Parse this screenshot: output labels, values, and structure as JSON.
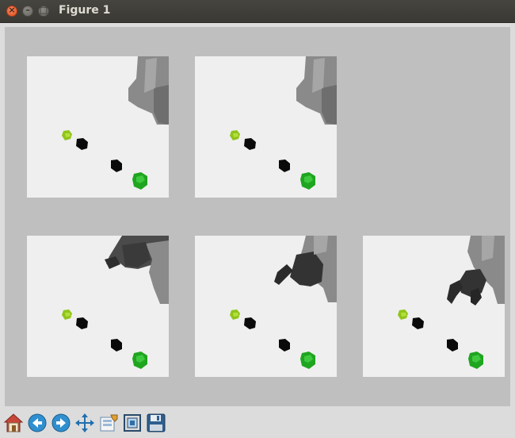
{
  "window": {
    "title": "Figure 1"
  },
  "titlebar": {
    "close_icon": "close-icon",
    "minimize_icon": "minimize-icon",
    "maximize_icon": "maximize-icon"
  },
  "figure": {
    "rows": 2,
    "panels": [
      {
        "name": "panel-row1-col1",
        "arm_pose": "arm-up"
      },
      {
        "name": "panel-row1-col2",
        "arm_pose": "arm-up"
      },
      {
        "name": "panel-row2-col1",
        "arm_pose": "gripper-top"
      },
      {
        "name": "panel-row2-col2",
        "arm_pose": "gripper-mid"
      },
      {
        "name": "panel-row2-col3",
        "arm_pose": "gripper-low"
      }
    ],
    "colors": {
      "panel_bg": "#efefef",
      "canvas_bg": "#bfbfbf",
      "yellow_green_block": "#8fc41a",
      "black_block": "#0a0a0a",
      "green_block": "#1fa51f",
      "arm_gray": "#8a8a8a",
      "arm_dark": "#3c3c3c"
    }
  },
  "toolbar": {
    "tools": [
      "home-icon",
      "back-icon",
      "forward-icon",
      "pan-icon",
      "configure-subplots-icon",
      "zoom-to-rect-icon",
      "save-icon"
    ]
  }
}
